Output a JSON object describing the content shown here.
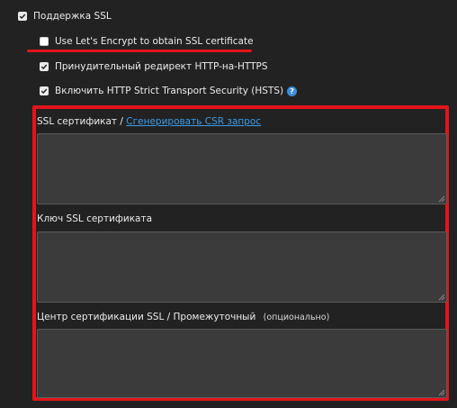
{
  "ssl_support": {
    "label": "Поддержка SSL",
    "checked": true
  },
  "letsencrypt": {
    "label": "Use Let's Encrypt to obtain SSL certificate",
    "checked": false
  },
  "force_https": {
    "label": "Принудительный редирект HTTP-на-HTTPS",
    "checked": true
  },
  "hsts": {
    "label": "Включить HTTP Strict Transport Security (HSTS)",
    "checked": true,
    "help_glyph": "?"
  },
  "certificate": {
    "label": "SSL сертификат /",
    "link": "Сгенерировать CSR запрос",
    "value": ""
  },
  "private_key": {
    "label": "Ключ SSL сертификата",
    "value": ""
  },
  "ca_chain": {
    "label": "Центр сертификации SSL / Промежуточный",
    "optional": "(опционально)",
    "value": ""
  },
  "colors": {
    "highlight": "#e3141a",
    "link": "#3d9be9",
    "background": "#222222",
    "field": "#3b3b3b"
  }
}
